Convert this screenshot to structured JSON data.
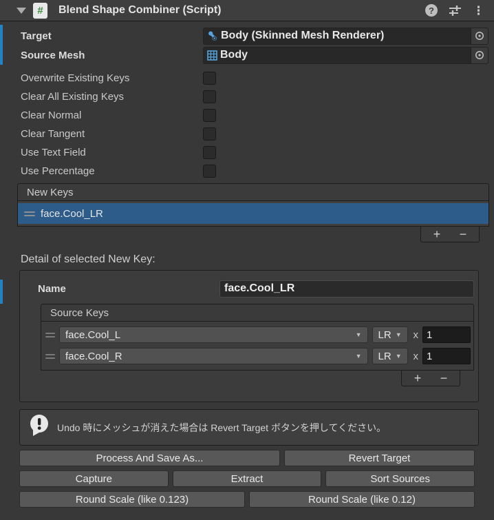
{
  "colors": {
    "bg": "#383838",
    "header_bg": "#3E3E3E",
    "field_bg": "#282828",
    "button_bg": "#585858",
    "selection_blue": "#2D5C8B",
    "override_blue": "#2383C4",
    "icon_blue": "#55A3DC",
    "script_icon_green": "#3E8E41"
  },
  "header": {
    "title": "Blend Shape Combiner (Script)"
  },
  "object_fields": {
    "target": {
      "label": "Target",
      "value": "Body (Skinned Mesh Renderer)"
    },
    "source_mesh": {
      "label": "Source Mesh",
      "value": "Body"
    }
  },
  "checkboxes": [
    {
      "label": "Overwrite Existing Keys",
      "checked": false
    },
    {
      "label": "Clear All Existing Keys",
      "checked": false
    },
    {
      "label": "Clear Normal",
      "checked": false
    },
    {
      "label": "Clear Tangent",
      "checked": false
    },
    {
      "label": "Use Text Field",
      "checked": false
    },
    {
      "label": "Use Percentage",
      "checked": false
    }
  ],
  "new_keys": {
    "header": "New Keys",
    "selected_item": "face.Cool_LR",
    "add_label": "+",
    "remove_label": "−"
  },
  "detail": {
    "section_label": "Detail of selected New Key:",
    "name_label": "Name",
    "name_value": "face.Cool_LR",
    "source_keys": {
      "header": "Source Keys",
      "rows": [
        {
          "key": "face.Cool_L",
          "mode": "LR",
          "times_label": "x",
          "multiplier": "1"
        },
        {
          "key": "face.Cool_R",
          "mode": "LR",
          "times_label": "x",
          "multiplier": "1"
        }
      ],
      "add_label": "+",
      "remove_label": "−"
    }
  },
  "help_box": {
    "text": "Undo 時にメッシュが消えた場合は Revert Target ボタンを押してください。"
  },
  "action_buttons": {
    "row1": [
      "Process And Save As...",
      "Revert Target"
    ],
    "row2": [
      "Capture",
      "Extract",
      "Sort Sources"
    ],
    "row3": [
      "Round Scale (like 0.123)",
      "Round Scale (like 0.12)"
    ]
  }
}
